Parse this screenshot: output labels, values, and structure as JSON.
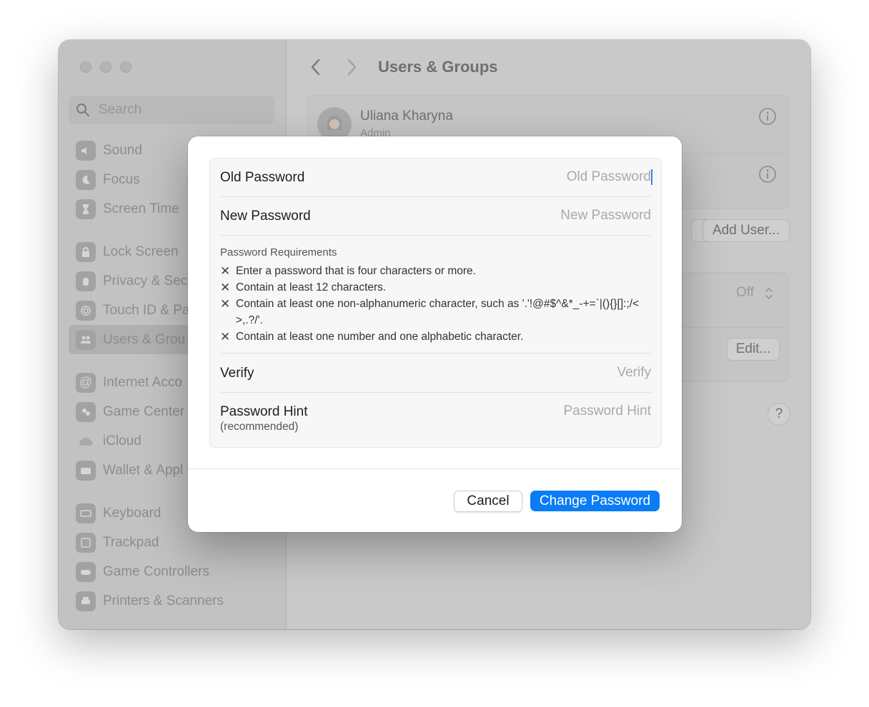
{
  "window": {
    "title": "Users & Groups",
    "search_placeholder": "Search"
  },
  "sidebar": {
    "items": [
      {
        "label": "Sound",
        "icon": "speaker-icon"
      },
      {
        "label": "Focus",
        "icon": "moon-icon"
      },
      {
        "label": "Screen Time",
        "icon": "hourglass-icon"
      },
      {
        "label": "Lock Screen",
        "icon": "lock-icon"
      },
      {
        "label": "Privacy & Sec",
        "icon": "hand-icon"
      },
      {
        "label": "Touch ID & Pa",
        "icon": "fingerprint-icon"
      },
      {
        "label": "Users & Grou",
        "icon": "users-icon",
        "selected": true
      },
      {
        "label": "Internet Acco",
        "icon": "at-icon"
      },
      {
        "label": "Game Center",
        "icon": "game-center-icon"
      },
      {
        "label": "iCloud",
        "icon": "cloud-icon"
      },
      {
        "label": "Wallet & Appl",
        "icon": "wallet-icon"
      },
      {
        "label": "Keyboard",
        "icon": "keyboard-icon"
      },
      {
        "label": "Trackpad",
        "icon": "trackpad-icon"
      },
      {
        "label": "Game Controllers",
        "icon": "gamepad-icon"
      },
      {
        "label": "Printers & Scanners",
        "icon": "printer-icon"
      }
    ]
  },
  "main": {
    "user_name": "Uliana Kharyna",
    "user_role": "Admin",
    "add_user_label": "Add User...",
    "partial_button_label": "..",
    "off_label": "Off",
    "edit_label": "Edit...",
    "help_label": "?"
  },
  "dialog": {
    "old_password_label": "Old Password",
    "old_password_placeholder": "Old Password",
    "new_password_label": "New Password",
    "new_password_placeholder": "New Password",
    "requirements_title": "Password Requirements",
    "requirements": [
      "Enter a password that is four characters or more.",
      "Contain at least 12 characters.",
      "Contain at least one non-alphanumeric character, such as '.'!@#$^&*_-+=`|(){}[]:;/<>,.?/'.",
      "Contain at least one number and one alphabetic character."
    ],
    "verify_label": "Verify",
    "verify_placeholder": "Verify",
    "hint_label": "Password Hint",
    "hint_sublabel": "(recommended)",
    "hint_placeholder": "Password Hint",
    "cancel_label": "Cancel",
    "submit_label": "Change Password"
  },
  "colors": {
    "accent": "#0a7cf5",
    "dim_overlay": "#c9c9c9"
  }
}
